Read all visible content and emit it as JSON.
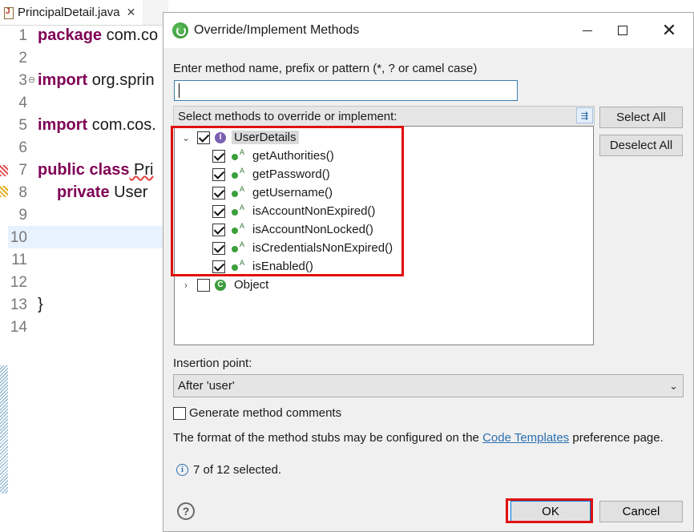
{
  "editor": {
    "tab_title": "PrincipalDetail.java",
    "tab_close_glyph": "✕",
    "fold_glyph": "⊖",
    "lines": [
      {
        "num": "1",
        "kw": "package",
        "rest": " com.co"
      },
      {
        "num": "2",
        "kw": "",
        "rest": ""
      },
      {
        "num": "3",
        "kw": "import",
        "rest": " org.sprin"
      },
      {
        "num": "4",
        "kw": "",
        "rest": ""
      },
      {
        "num": "5",
        "kw": "import",
        "rest": " com.cos."
      },
      {
        "num": "6",
        "kw": "",
        "rest": ""
      },
      {
        "num": "7",
        "kw": "public class",
        "rest": " Pri"
      },
      {
        "num": "8",
        "kw": "private",
        "rest": " User"
      },
      {
        "num": "9",
        "kw": "",
        "rest": ""
      },
      {
        "num": "10",
        "kw": "",
        "rest": ""
      },
      {
        "num": "11",
        "kw": "",
        "rest": ""
      },
      {
        "num": "12",
        "kw": "",
        "rest": ""
      },
      {
        "num": "13",
        "kw": "",
        "rest": "}"
      },
      {
        "num": "14",
        "kw": "",
        "rest": ""
      }
    ]
  },
  "dialog": {
    "title": "Override/Implement Methods",
    "window_controls": {
      "close": "✕"
    },
    "filter_label": "Enter method name, prefix or pattern (*, ? or camel case)",
    "filter_value": "",
    "tree_header": "Select methods to override or implement:",
    "tree": {
      "twisty_expanded": "⌄",
      "twisty_collapsed": "›",
      "abstract_mark": "A",
      "interface_badge": "I",
      "class_badge": "C",
      "groups": [
        {
          "label": "UserDetails",
          "checked": true,
          "expanded": true,
          "icon": "interface-icon",
          "methods": [
            {
              "label": "getAuthorities()",
              "checked": true
            },
            {
              "label": "getPassword()",
              "checked": true
            },
            {
              "label": "getUsername()",
              "checked": true
            },
            {
              "label": "isAccountNonExpired()",
              "checked": true
            },
            {
              "label": "isAccountNonLocked()",
              "checked": true
            },
            {
              "label": "isCredentialsNonExpired()",
              "checked": true
            },
            {
              "label": "isEnabled()",
              "checked": true
            }
          ]
        },
        {
          "label": "Object",
          "checked": false,
          "expanded": false,
          "icon": "class-icon",
          "methods": []
        }
      ]
    },
    "select_all": "Select All",
    "deselect_all": "Deselect All",
    "insertion_label": "Insertion point:",
    "insertion_value": "After 'user'",
    "generate_comments": {
      "label": "Generate method comments",
      "checked": false
    },
    "format_text_before": "The format of the method stubs may be configured on the ",
    "format_link": "Code Templates",
    "format_text_after": " preference page.",
    "status": "7 of 12 selected.",
    "info_glyph": "i",
    "help_glyph": "?",
    "ok": "OK",
    "cancel": "Cancel"
  },
  "highlight_color": "#e01010",
  "link_color": "#2a6fb0"
}
